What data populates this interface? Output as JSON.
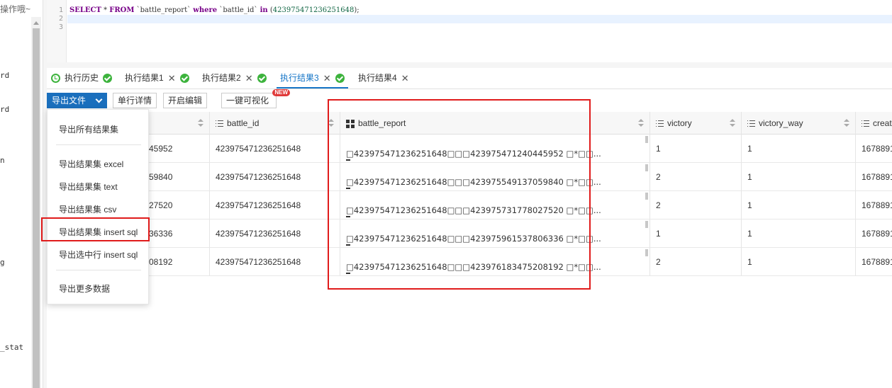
{
  "left_panel": {
    "header": "操作哦~",
    "tree_fragments": [
      "rd",
      "rd",
      "n",
      "g",
      "_stat"
    ]
  },
  "editor": {
    "line_numbers": [
      "1",
      "2",
      "3"
    ],
    "sql": {
      "kw_select": "SELECT",
      "star": " * ",
      "kw_from": "FROM",
      "table": " `battle_report` ",
      "kw_where": "where",
      "column": " `battle_id`   ",
      "kw_in": "in",
      "value_open": " (",
      "value": "423975471236251648",
      "value_close": ");"
    }
  },
  "tabs": [
    {
      "label": "执行历史",
      "status": "ok",
      "closable": false,
      "active": false
    },
    {
      "label": "执行结果1",
      "status": "ok",
      "closable": true,
      "active": false
    },
    {
      "label": "执行结果2",
      "status": "ok",
      "closable": true,
      "active": false
    },
    {
      "label": "执行结果3",
      "status": "ok",
      "closable": true,
      "active": true
    },
    {
      "label": "执行结果4",
      "status": "none",
      "closable": true,
      "active": false
    }
  ],
  "toolbar": {
    "export_label": "导出文件",
    "row_detail_label": "单行详情",
    "edit_label": "开启编辑",
    "visualize_label": "一键可视化",
    "new_badge": "NEW"
  },
  "export_menu": {
    "items": [
      "导出所有结果集",
      "导出结果集 excel",
      "导出结果集 text",
      "导出结果集 csv",
      "导出结果集 insert sql",
      "导出选中行 insert sql",
      "导出更多数据"
    ]
  },
  "grid": {
    "columns": [
      "",
      "battle_id",
      "battle_report",
      "victory",
      "victory_way",
      "creat"
    ],
    "rows": [
      {
        "id_tail": "45952",
        "battle_id": "423975471236251648",
        "battle_report": "□423975471236251648□□□423975471240445952 □*□□...",
        "victory": "1",
        "victory_way": "1",
        "create": "1678891"
      },
      {
        "id_tail": "59840",
        "battle_id": "423975471236251648",
        "battle_report": "□423975471236251648□□□423975549137059840 □*□□...",
        "victory": "2",
        "victory_way": "1",
        "create": "1678891"
      },
      {
        "id_tail": "27520",
        "battle_id": "423975471236251648",
        "battle_report": "□423975471236251648□□□423975731778027520 □*□□...",
        "victory": "2",
        "victory_way": "1",
        "create": "1678891"
      },
      {
        "id_tail": "36336",
        "battle_id": "423975471236251648",
        "battle_report": "□423975471236251648□□□423975961537806336 □*□□...",
        "victory": "1",
        "victory_way": "1",
        "create": "1678891"
      },
      {
        "id_tail": "08192",
        "battle_id": "423975471236251648",
        "battle_report": "□423975471236251648□□□423976183475208192 □*□□...",
        "victory": "2",
        "victory_way": "1",
        "create": "1678891"
      }
    ]
  },
  "colors": {
    "accent": "#1676c7",
    "primary_button": "#1a6fbd",
    "ok_green": "#3db33d",
    "highlight_red": "#e01b1b",
    "badge_red": "#e03a3a"
  }
}
